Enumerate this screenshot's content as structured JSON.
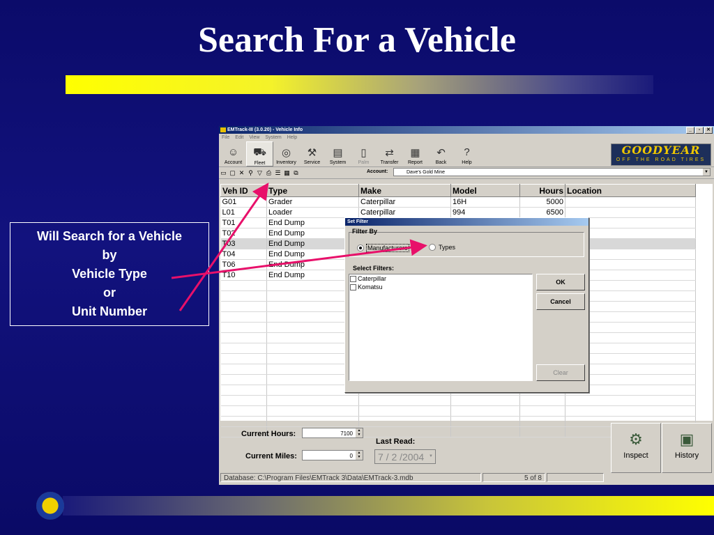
{
  "slide": {
    "title": "Search For a Vehicle"
  },
  "callout": {
    "lines": [
      "Will Search for a Vehicle",
      "by",
      "Vehicle Type",
      "or",
      "Unit Number"
    ]
  },
  "app": {
    "window_title": "EMTrack-III (3.0.20) - Vehicle Info",
    "menu": [
      "File",
      "Edit",
      "View",
      "System",
      "Help"
    ],
    "toolbar": [
      {
        "label": "Account",
        "icon": "account-icon"
      },
      {
        "label": "Fleet",
        "icon": "fleet-icon"
      },
      {
        "label": "Inventory",
        "icon": "inventory-icon"
      },
      {
        "label": "Service",
        "icon": "service-icon"
      },
      {
        "label": "System",
        "icon": "system-icon"
      },
      {
        "label": "Palm",
        "icon": "palm-icon"
      },
      {
        "label": "Transfer",
        "icon": "transfer-icon"
      },
      {
        "label": "Report",
        "icon": "report-icon"
      },
      {
        "label": "Back",
        "icon": "back-icon"
      },
      {
        "label": "Help",
        "icon": "help-icon"
      }
    ],
    "brand": {
      "name": "GOODYEAR",
      "tagline": "OFF THE ROAD TIRES"
    },
    "account": {
      "label": "Account:",
      "value": "Dave's Gold Mine"
    },
    "table": {
      "columns": [
        "Veh ID",
        "Type",
        "Make",
        "Model",
        "Hours",
        "Location"
      ],
      "rows": [
        [
          "G01",
          "Grader",
          "Caterpillar",
          "16H",
          "5000",
          ""
        ],
        [
          "L01",
          "Loader",
          "Caterpillar",
          "994",
          "6500",
          ""
        ],
        [
          "T01",
          "End Dump",
          "",
          "",
          "",
          ""
        ],
        [
          "T02",
          "End Dump",
          "",
          "",
          "",
          ""
        ],
        [
          "T03",
          "End Dump",
          "",
          "",
          "",
          ""
        ],
        [
          "T04",
          "End Dump",
          "",
          "",
          "",
          ""
        ],
        [
          "T06",
          "End Dump",
          "",
          "",
          "",
          ""
        ],
        [
          "T10",
          "End Dump",
          "",
          "",
          "",
          ""
        ]
      ]
    },
    "current_hours": {
      "label": "Current Hours:",
      "value": "7100"
    },
    "current_miles": {
      "label": "Current Miles:",
      "value": "0"
    },
    "last_read": {
      "label": "Last Read:",
      "value": "7 / 2 /2004"
    },
    "inspect_label": "Inspect",
    "history_label": "History",
    "status": {
      "database": "Database: C:\\Program Files\\EMTrack 3\\Data\\EMTrack-3.mdb",
      "record": "5 of 8"
    }
  },
  "dialog": {
    "title": "Set Filter",
    "filter_by_label": "Filter By",
    "option_manufacturers": "Manufacturers",
    "option_types": "Types",
    "select_filters_label": "Select Filters:",
    "filters": [
      "Caterpillar",
      "Komatsu"
    ],
    "ok_label": "OK",
    "cancel_label": "Cancel",
    "clear_label": "Clear"
  },
  "colors": {
    "slide_background": "#0d0d70",
    "accent_yellow": "#ffff00",
    "arrow": "#e8106a",
    "title_bar": "#0a246a"
  }
}
